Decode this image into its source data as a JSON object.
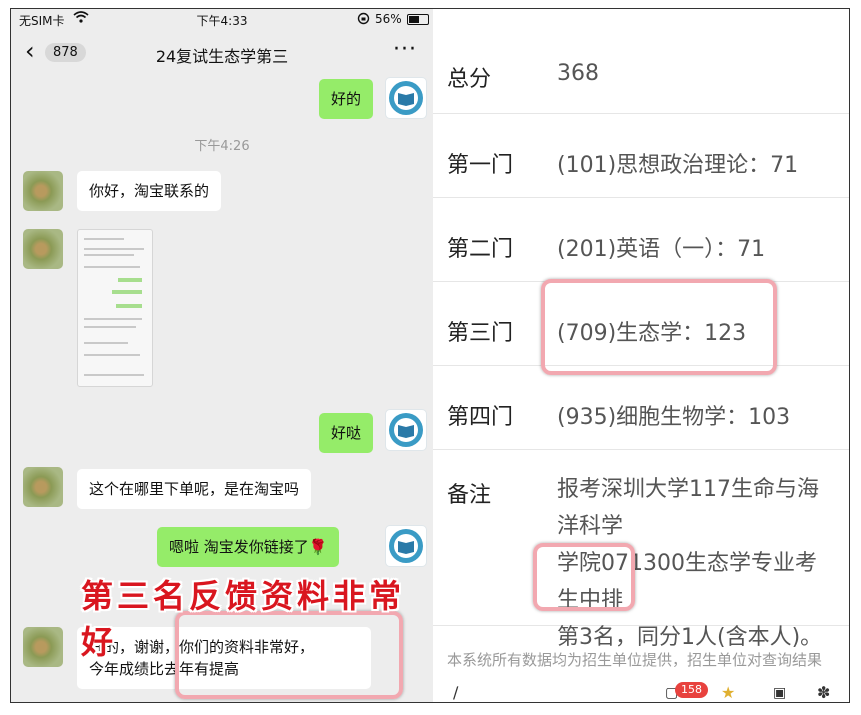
{
  "status_bar": {
    "carrier": "无SIM卡",
    "time": "下午4:33",
    "battery": "56%",
    "battery_level": 0.56
  },
  "chat_header": {
    "back_count": "878",
    "title": "24复试生态学第三",
    "more": "···"
  },
  "messages": [
    {
      "side": "out",
      "text": "好的"
    },
    {
      "timestamp": "下午4:26"
    },
    {
      "side": "in",
      "text": "你好，淘宝联系的"
    },
    {
      "side": "in",
      "type": "image"
    },
    {
      "side": "out",
      "text": "好哒"
    },
    {
      "side": "in",
      "text": "这个在哪里下单呢，是在淘宝吗"
    },
    {
      "side": "out",
      "text": "嗯啦 淘宝发你链接了🌹"
    },
    {
      "side": "in",
      "text_line1": "好的，谢谢，你们的资料非常好，",
      "text_line2": "今年成绩比去年有提高"
    }
  ],
  "caption": "第三名反馈资料非常好",
  "scores": {
    "total_label": "总分",
    "total_value": "368",
    "rows": [
      {
        "label": "第一门",
        "value": "(101)思想政治理论：71"
      },
      {
        "label": "第二门",
        "value": "(201)英语（一）：71"
      },
      {
        "label": "第三门",
        "value": "(709)生态学：123"
      },
      {
        "label": "第四门",
        "value": "(935)细胞生物学：103"
      }
    ],
    "remark_label": "备注",
    "remark_line1": "报考深圳大学117生命与海洋科学",
    "remark_line2": "学院071300生态学专业考生中排",
    "remark_line3": "第3名，同分1人(含本人)。",
    "footer": "本系统所有数据均为招生单位提供，招生单位对查询结果",
    "notification_count": "158"
  },
  "colors": {
    "chat_bg": "#ededed",
    "out_bubble": "#95ec69",
    "caption_red": "#d9161f",
    "highlight_pink": "#f2a8b0"
  }
}
